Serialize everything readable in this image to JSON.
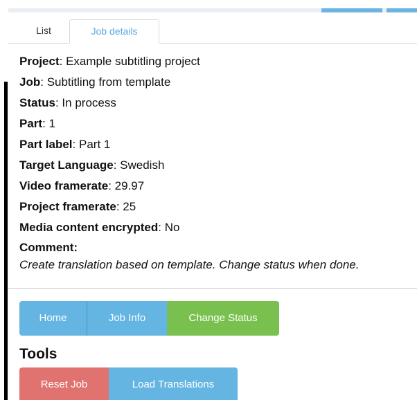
{
  "tabs": [
    {
      "label": "List"
    },
    {
      "label": "Job details"
    }
  ],
  "details": {
    "project": {
      "label": "Project",
      "value": "Example subtitling project"
    },
    "job": {
      "label": "Job",
      "value": "Subtitling from template"
    },
    "status": {
      "label": "Status",
      "value": "In process"
    },
    "part": {
      "label": "Part",
      "value": "1"
    },
    "part_label": {
      "label": "Part label",
      "value": "Part 1"
    },
    "target_language": {
      "label": "Target Language",
      "value": "Swedish"
    },
    "video_framerate": {
      "label": "Video framerate",
      "value": "29.97"
    },
    "project_framerate": {
      "label": "Project framerate",
      "value": "25"
    },
    "media_encrypted": {
      "label": "Media content encrypted",
      "value": "No"
    },
    "comment": {
      "label": "Comment",
      "value": "Create translation based on template. Change status when done."
    }
  },
  "actions": {
    "home": "Home",
    "job_info": "Job Info",
    "change_status": "Change Status"
  },
  "tools": {
    "title": "Tools",
    "reset_job": "Reset Job",
    "load_translations": "Load Translations"
  },
  "colors": {
    "tab_active_text": "#5aa9e0",
    "button_blue": "#64b5e2",
    "button_green": "#7ac04f",
    "button_red": "#e0736f"
  }
}
